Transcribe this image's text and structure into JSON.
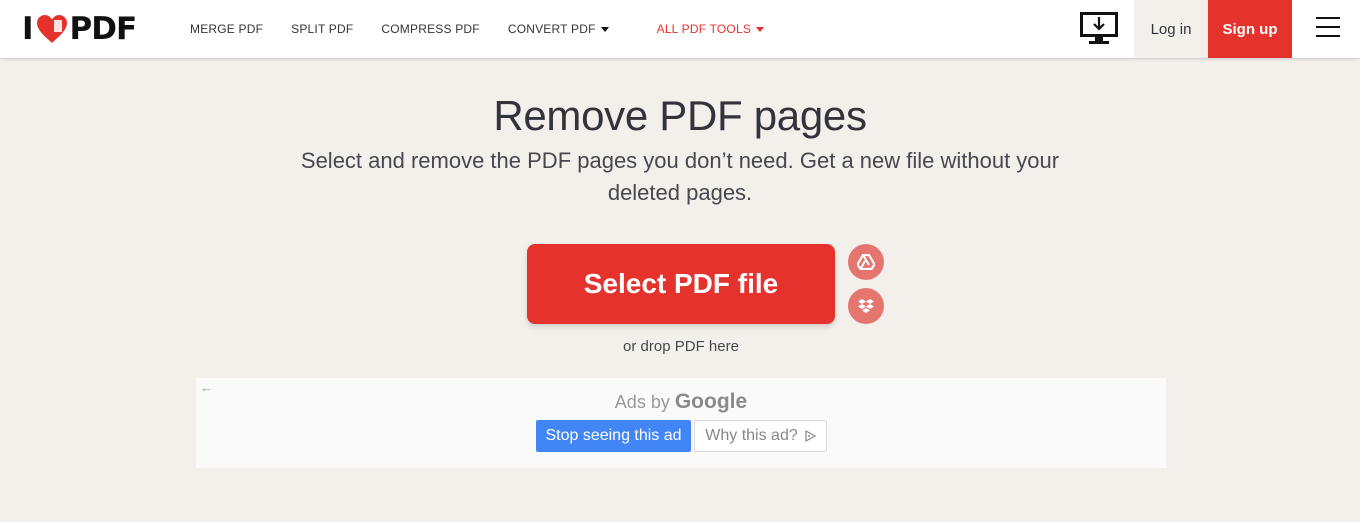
{
  "header": {
    "logo": {
      "left": "I",
      "right": "PDF",
      "heart_color": "#e5322d"
    },
    "nav": [
      {
        "label": "MERGE PDF",
        "has_caret": false,
        "red": false
      },
      {
        "label": "SPLIT PDF",
        "has_caret": false,
        "red": false
      },
      {
        "label": "COMPRESS PDF",
        "has_caret": false,
        "red": false
      },
      {
        "label": "CONVERT PDF",
        "has_caret": true,
        "red": false
      },
      {
        "label": "ALL PDF TOOLS",
        "has_caret": true,
        "red": true
      }
    ],
    "desktop_icon": "desktop-download-icon",
    "login_label": "Log in",
    "signup_label": "Sign up",
    "menu_icon": "hamburger-menu-icon"
  },
  "hero": {
    "title": "Remove PDF pages",
    "subtitle": "Select and remove the PDF pages you don’t need. Get a new file without your deleted pages.",
    "select_button": "Select PDF file",
    "gdrive_icon": "google-drive-icon",
    "dropbox_icon": "dropbox-icon",
    "drop_hint": "or drop PDF here"
  },
  "ad": {
    "back_icon": "back-arrow-icon",
    "ads_by": "Ads by",
    "google": "Google",
    "stop_label": "Stop seeing this ad",
    "why_label": "Why this ad?",
    "info_icon": "ad-choices-icon"
  },
  "colors": {
    "accent": "#e5322d",
    "background": "#f3f0ec",
    "secondary_round": "#e5756f",
    "ad_blue": "#4285f4"
  }
}
